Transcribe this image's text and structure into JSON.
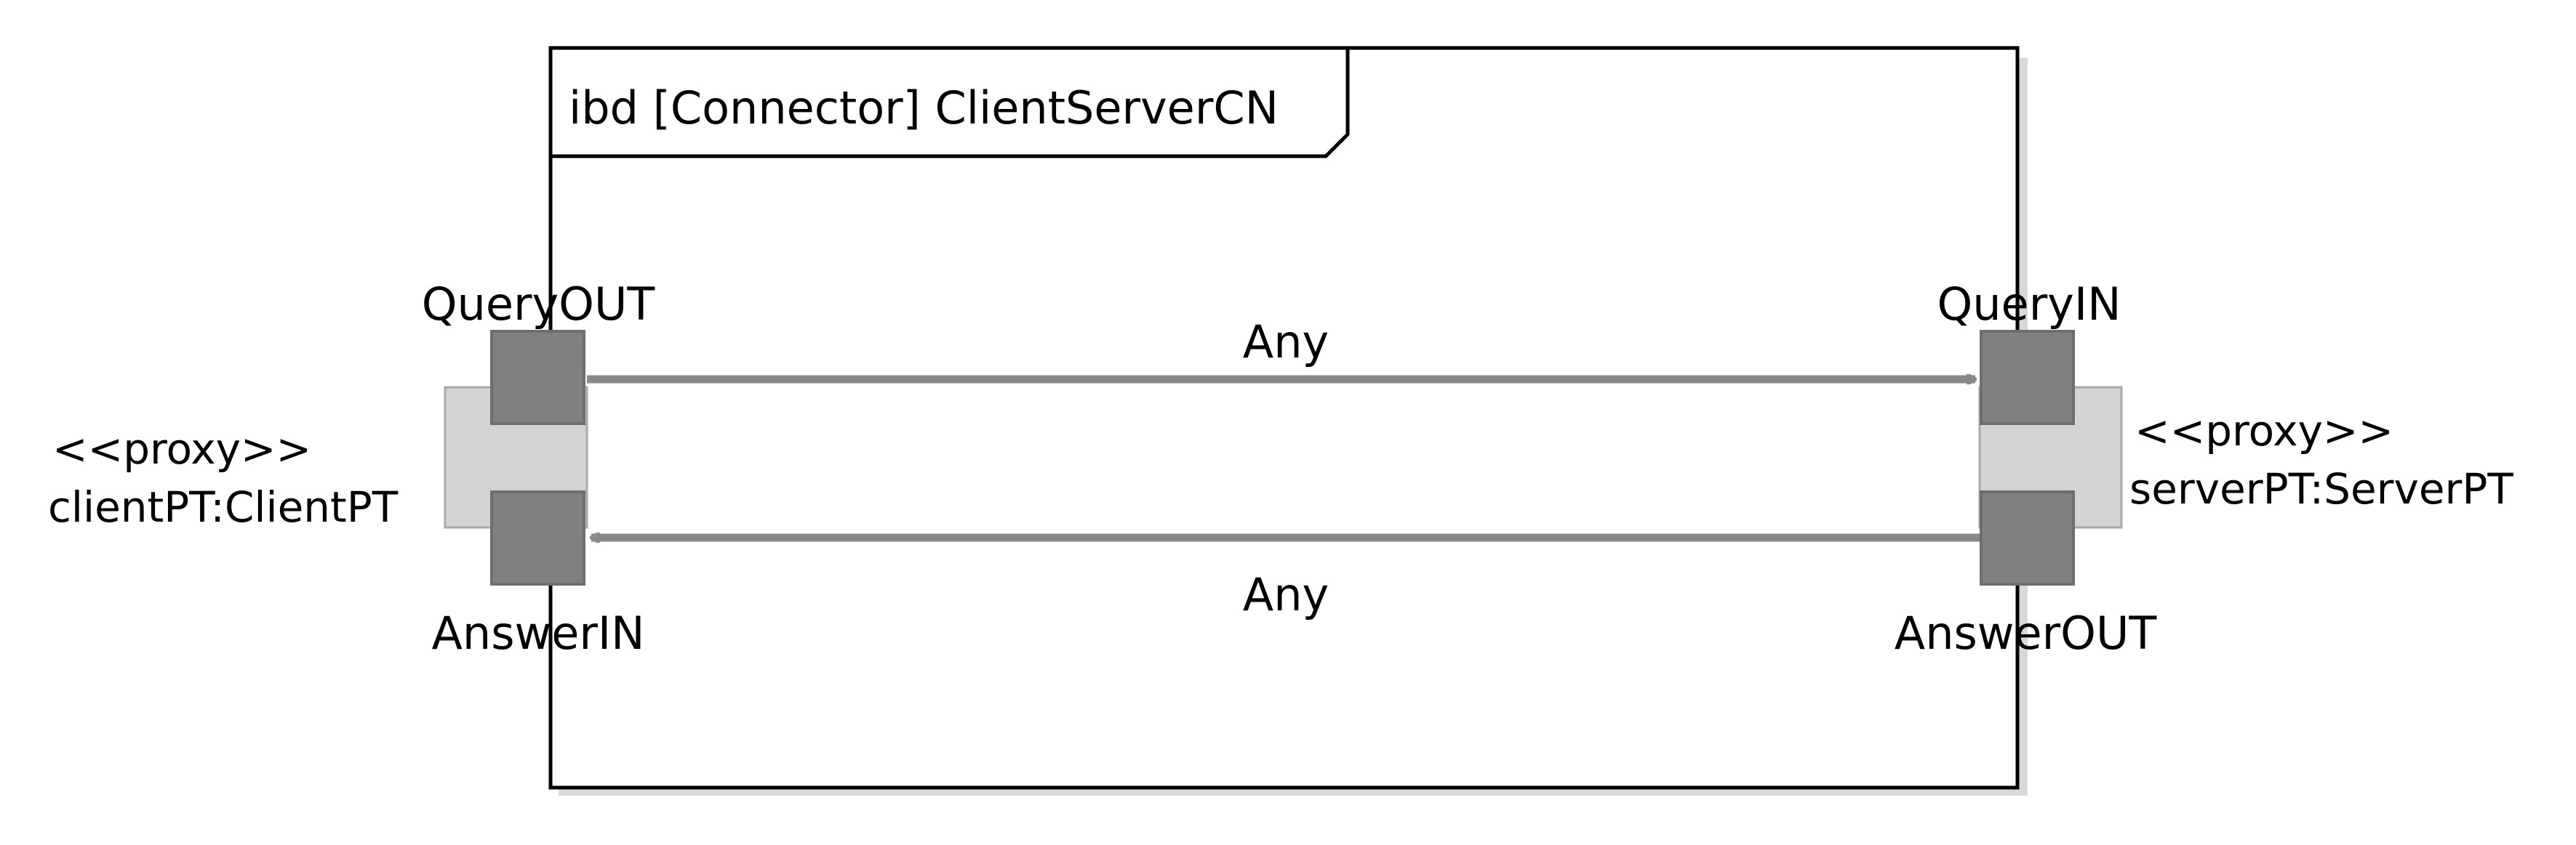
{
  "frame": {
    "header": "ibd [Connector] ClientServerCN"
  },
  "proxies": {
    "client": {
      "stereotype": "<<proxy>>",
      "name": "clientPT:ClientPT"
    },
    "server": {
      "stereotype": "<<proxy>>",
      "name": "serverPT:ServerPT"
    }
  },
  "ports": {
    "query_out": "QueryOUT",
    "answer_in": "AnswerIN",
    "query_in": "QueryIN",
    "answer_out": "AnswerOUT"
  },
  "connectors": {
    "query": {
      "label": "Any",
      "direction": "client-to-server"
    },
    "answer": {
      "label": "Any",
      "direction": "server-to-client"
    }
  },
  "colors": {
    "frame": "#000000",
    "port": "#808080",
    "port_border": "#6e6e6e",
    "proxy_fill": "#d3d3d3",
    "proxy_border": "#a8a8a8",
    "connector": "#888888",
    "shadow": "#d8d8d8"
  }
}
